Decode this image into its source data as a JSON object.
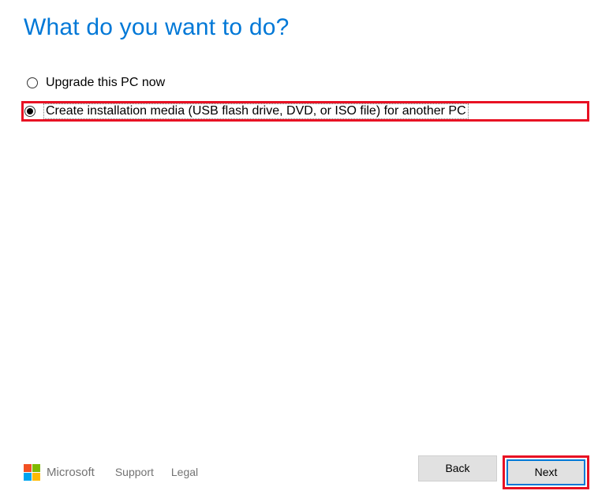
{
  "title": "What do you want to do?",
  "options": {
    "upgrade": {
      "label": "Upgrade this PC now",
      "selected": false
    },
    "create_media": {
      "label": "Create installation media (USB flash drive, DVD, or ISO file) for another PC",
      "selected": true
    }
  },
  "footer": {
    "brand": "Microsoft",
    "support": "Support",
    "legal": "Legal"
  },
  "buttons": {
    "back": "Back",
    "next": "Next"
  }
}
